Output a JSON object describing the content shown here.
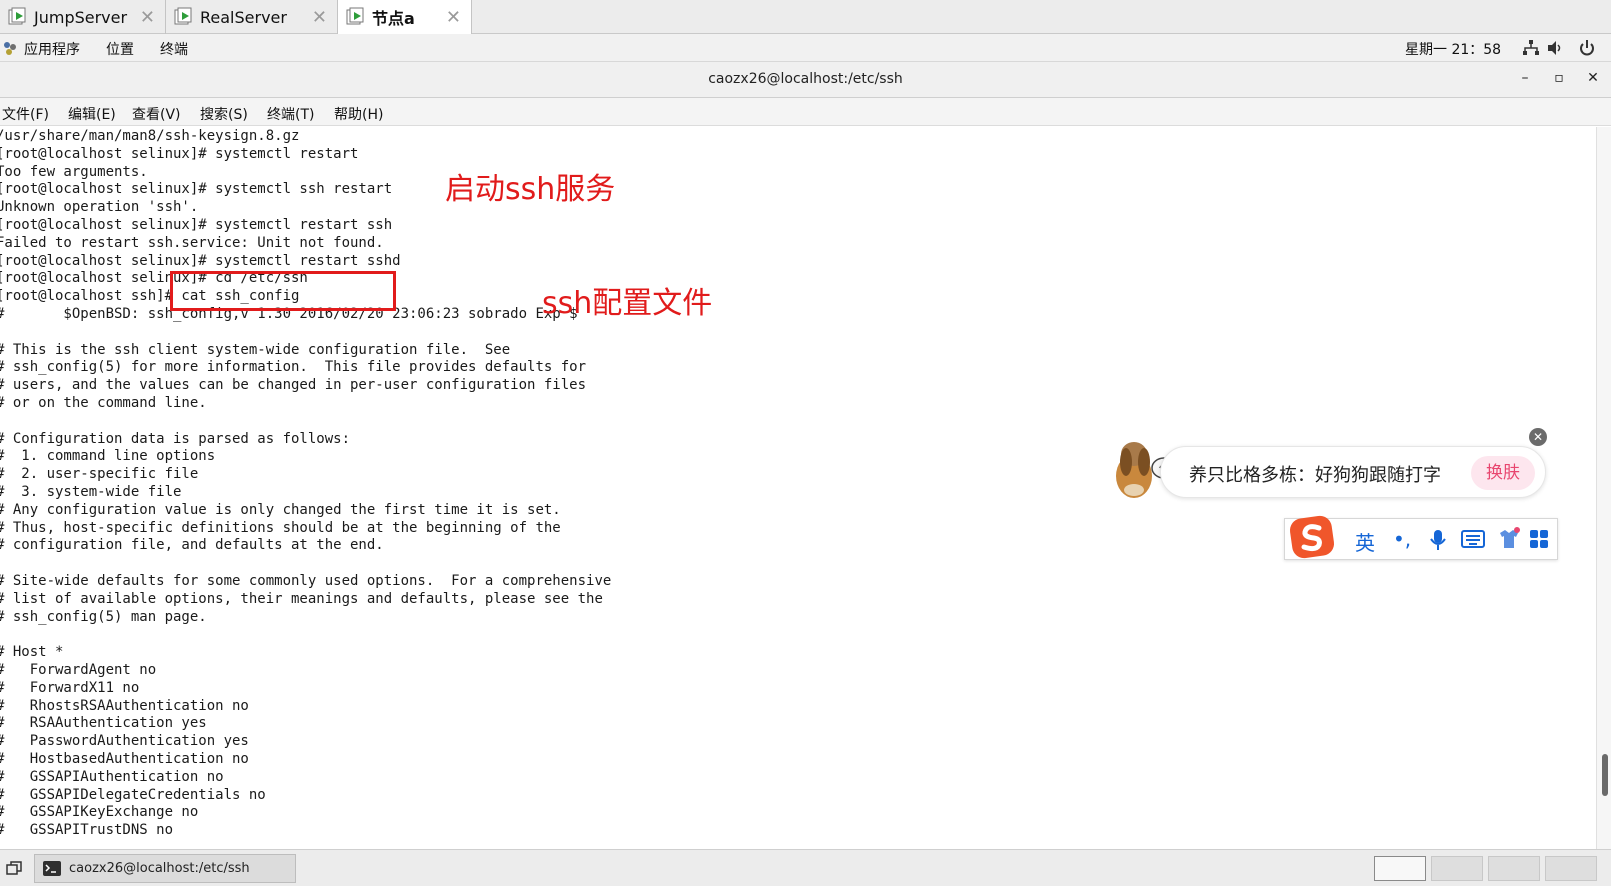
{
  "vm_tabs": [
    {
      "label": "JumpServer",
      "close": "✕"
    },
    {
      "label": "RealServer",
      "close": "✕"
    },
    {
      "label": "节点a",
      "close": "✕"
    }
  ],
  "gnome_bar": {
    "apps": "应用程序",
    "places": "位置",
    "terminal": "终端",
    "clock": "星期一 21：58"
  },
  "window": {
    "title": "caozx26@localhost:/etc/ssh",
    "minimize": "–",
    "maximize": "▫",
    "close": "✕"
  },
  "menu": {
    "file": "文件(F)",
    "edit": "编辑(E)",
    "view": "查看(V)",
    "search": "搜索(S)",
    "terminal": "终端(T)",
    "help": "帮助(H)"
  },
  "terminal_lines": [
    "/usr/share/man/man8/ssh-keysign.8.gz",
    "[root@localhost selinux]# systemctl restart",
    "Too few arguments.",
    "[root@localhost selinux]# systemctl ssh restart",
    "Unknown operation 'ssh'.",
    "[root@localhost selinux]# systemctl restart ssh",
    "Failed to restart ssh.service: Unit not found.",
    "[root@localhost selinux]# systemctl restart sshd",
    "[root@localhost selinux]# cd /etc/ssh",
    "[root@localhost ssh]# cat ssh_config",
    "#       $OpenBSD: ssh_config,v 1.30 2016/02/20 23:06:23 sobrado Exp $",
    "",
    "# This is the ssh client system-wide configuration file.  See",
    "# ssh_config(5) for more information.  This file provides defaults for",
    "# users, and the values can be changed in per-user configuration files",
    "# or on the command line.",
    "",
    "# Configuration data is parsed as follows:",
    "#  1. command line options",
    "#  2. user-specific file",
    "#  3. system-wide file",
    "# Any configuration value is only changed the first time it is set.",
    "# Thus, host-specific definitions should be at the beginning of the",
    "# configuration file, and defaults at the end.",
    "",
    "# Site-wide defaults for some commonly used options.  For a comprehensive",
    "# list of available options, their meanings and defaults, please see the",
    "# ssh_config(5) man page.",
    "",
    "# Host *",
    "#   ForwardAgent no",
    "#   ForwardX11 no",
    "#   RhostsRSAAuthentication no",
    "#   RSAAuthentication yes",
    "#   PasswordAuthentication yes",
    "#   HostbasedAuthentication no",
    "#   GSSAPIAuthentication no",
    "#   GSSAPIDelegateCredentials no",
    "#   GSSAPIKeyExchange no",
    "#   GSSAPITrustDNS no"
  ],
  "annotations": {
    "start_ssh": "启动ssh服务",
    "ssh_config": "ssh配置文件"
  },
  "ime": {
    "banner_text": "养只比格多栋：好狗狗跟随打字",
    "skin_button": "换肤",
    "close": "✕",
    "lang": "英",
    "punct": "•,",
    "colors": {
      "brand": "#f0562b",
      "accent": "#1566d6"
    }
  },
  "taskbar": {
    "window_label": "caozx26@localhost:/etc/ssh"
  }
}
